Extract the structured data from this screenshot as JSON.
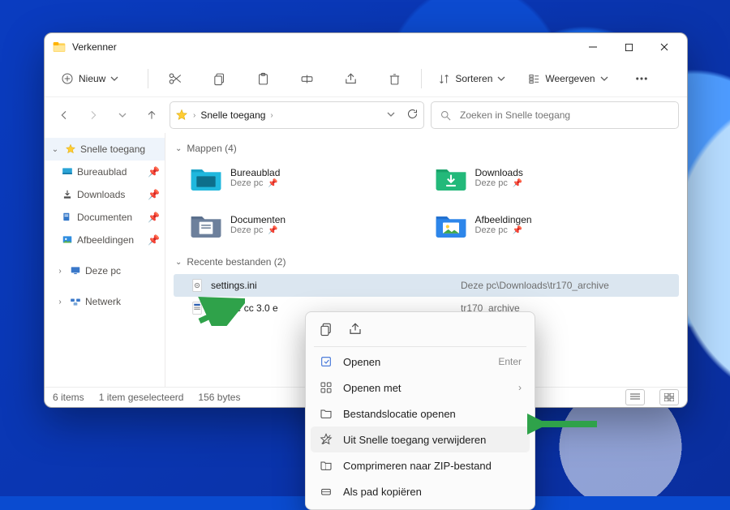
{
  "window": {
    "title": "Verkenner"
  },
  "toolbar": {
    "new_label": "Nieuw",
    "sort_label": "Sorteren",
    "view_label": "Weergeven"
  },
  "address": {
    "crumb1": "Snelle toegang"
  },
  "search": {
    "placeholder": "Zoeken in Snelle toegang"
  },
  "sidebar": {
    "quick_access": "Snelle toegang",
    "items": [
      {
        "label": "Bureaublad"
      },
      {
        "label": "Downloads"
      },
      {
        "label": "Documenten"
      },
      {
        "label": "Afbeeldingen"
      }
    ],
    "this_pc": "Deze pc",
    "network": "Netwerk"
  },
  "groups": {
    "folders_label": "Mappen (4)",
    "recent_label": "Recente bestanden (2)"
  },
  "folders": [
    {
      "name": "Bureaublad",
      "sub": "Deze pc"
    },
    {
      "name": "Downloads",
      "sub": "Deze pc"
    },
    {
      "name": "Documenten",
      "sub": "Deze pc"
    },
    {
      "name": "Afbeeldingen",
      "sub": "Deze pc"
    }
  ],
  "files": [
    {
      "name": "settings.ini",
      "path": "Deze pc\\Downloads\\tr170_archive"
    },
    {
      "name": "license cc 3.0 e",
      "path": "tr170_archive"
    }
  ],
  "status": {
    "count": "6 items",
    "selected": "1 item geselecteerd",
    "size": "156 bytes"
  },
  "context_menu": {
    "open": "Openen",
    "open_hint": "Enter",
    "open_with": "Openen met",
    "open_location": "Bestandslocatie openen",
    "remove_quick": "Uit Snelle toegang verwijderen",
    "compress": "Comprimeren naar ZIP-bestand",
    "copy_path": "Als pad kopiëren"
  },
  "colors": {
    "accent": "#0a4bd0",
    "arrow": "#2fa24a"
  }
}
